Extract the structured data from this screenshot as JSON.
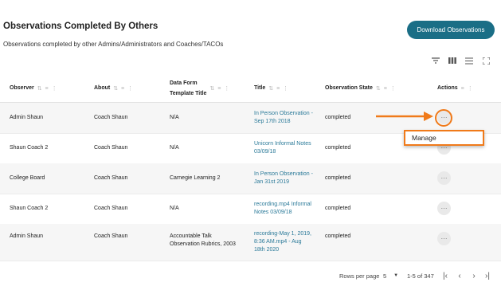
{
  "header": {
    "title": "Observations Completed By Others",
    "subtitle": "Observations completed by other Admins/Administrators and Coaches/TACOs",
    "download_button": "Download Observations"
  },
  "toolbar": {
    "icons": [
      "filter-icon",
      "columns-icon",
      "density-icon",
      "fullscreen-icon"
    ]
  },
  "table": {
    "columns": [
      {
        "label": "Observer"
      },
      {
        "label": "About"
      },
      {
        "label": "Data Form",
        "label2": "Template Title"
      },
      {
        "label": "Title"
      },
      {
        "label": "Observation State"
      },
      {
        "label": "Actions"
      }
    ],
    "rows": [
      {
        "observer": "Admin Shaun",
        "about": "Coach Shaun",
        "template": [
          "N/A"
        ],
        "title": [
          "In Person Observation -",
          "Sep 17th 2018"
        ],
        "state": "completed"
      },
      {
        "observer": "Shaun Coach 2",
        "about": "Coach Shaun",
        "template": [
          "N/A"
        ],
        "title": [
          "Unicorn Informal Notes",
          "03/09/18"
        ],
        "state": "completed"
      },
      {
        "observer": "College Board",
        "about": "Coach Shaun",
        "template": [
          "Carnegie Learning 2"
        ],
        "title": [
          "In Person Observation -",
          "Jan 31st 2019"
        ],
        "state": "completed"
      },
      {
        "observer": "Shaun Coach 2",
        "about": "Coach Shaun",
        "template": [
          "N/A"
        ],
        "title": [
          "recording.mp4 Informal",
          "Notes 03/09/18"
        ],
        "state": "completed"
      },
      {
        "observer": "Admin Shaun",
        "about": "Coach Shaun",
        "template": [
          "Accountable Talk",
          "Observation Rubrics, 2003"
        ],
        "title": [
          "recording-May 1, 2019,",
          "8:36 AM.mp4 - Aug",
          "18th 2020"
        ],
        "state": "completed"
      }
    ],
    "actions_glyph": "···"
  },
  "menu": {
    "item": "Manage"
  },
  "pagination": {
    "rows_per_page_label": "Rows per page",
    "rows_per_page_value": "5",
    "range": "1-5 of 347"
  },
  "colors": {
    "accent": "#1a6e86",
    "link": "#2b7a99",
    "annotation": "#f07a1a"
  }
}
